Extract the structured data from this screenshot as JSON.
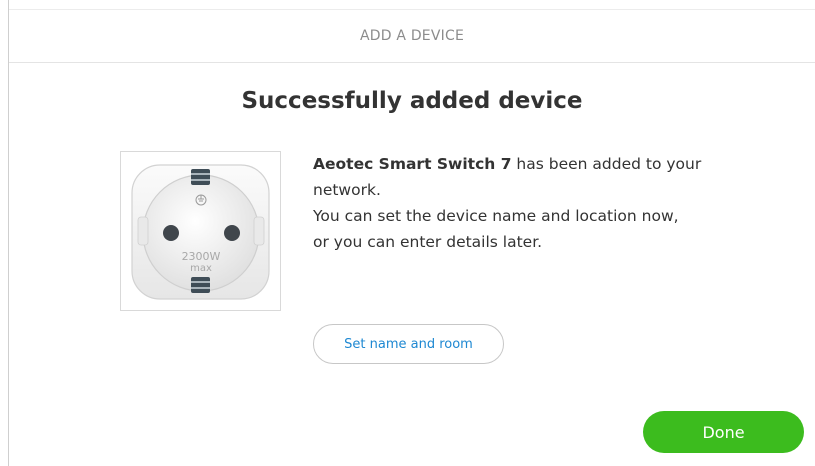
{
  "header": {
    "title": "ADD A DEVICE"
  },
  "main": {
    "title": "Successfully added device",
    "device": {
      "name": "Aeotec Smart Switch 7",
      "image_label_power": "2300W",
      "image_label_max": "max",
      "image_icon": "ground-symbol-icon"
    },
    "message": {
      "added_suffix": " has been added to your network.",
      "line2": "You can set the device name and location now,",
      "line3": "or you can enter details later."
    },
    "set_name_button": "Set name and room",
    "done_button": "Done"
  },
  "colors": {
    "accent_green": "#3cbc1e",
    "link_blue": "#1e88d2",
    "header_text": "#8c8c8c",
    "body_text": "#333333"
  }
}
